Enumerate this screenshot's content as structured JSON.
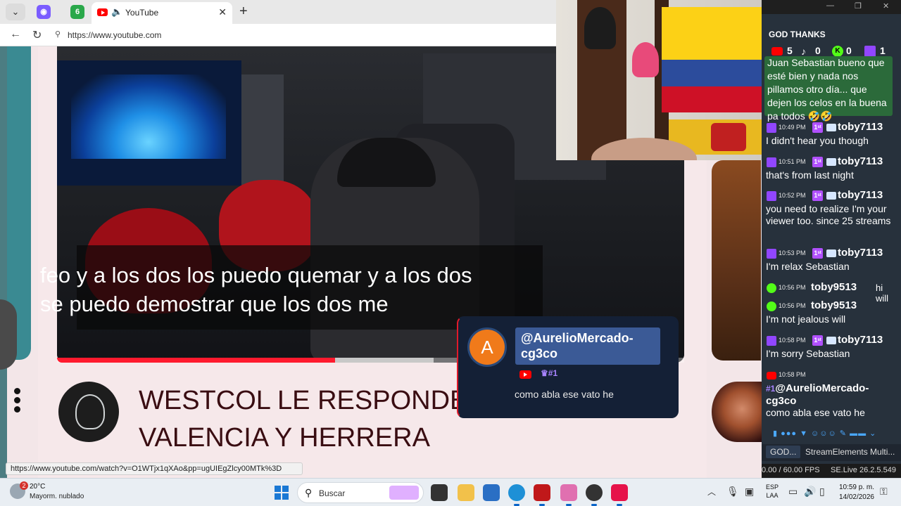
{
  "browser": {
    "tab_title": "YouTube",
    "mini_tab_2_label": "6",
    "url": "https://www.youtube.com",
    "status_url": "https://www.youtube.com/watch?v=O1WTjx1qXAo&pp=ugUIEgZlcy00MTk%3D"
  },
  "video": {
    "subtitle": "feo y a los dos los puedo quemar y a los dos se puedo demostrar que los dos me",
    "progress_fraction": 0.443,
    "buffer_fraction": 0.6,
    "title": "WESTCOL LE RESPONDE A VALENCIA Y HERRERA"
  },
  "notification": {
    "avatar_letter": "A",
    "username": "@AurelioMercado-cg3co",
    "badge": "#1",
    "message": "como abla ese vato he"
  },
  "chat": {
    "header": "GOD THANKS",
    "counts": {
      "youtube": "5",
      "tiktok": "0",
      "kick": "0",
      "twitch": "1"
    },
    "first_message": "Juan Sebastian bueno que esté bien y nada nos pillamos otro día... que dejen los celos en la buena pa todos 🤣🤣",
    "messages": [
      {
        "platform": "twitch",
        "time": "10:49 PM",
        "user": "toby7113",
        "text": "I didn't hear you though"
      },
      {
        "platform": "twitch",
        "time": "10:51 PM",
        "user": "toby7113",
        "text": "that's from last night"
      },
      {
        "platform": "twitch",
        "time": "10:52 PM",
        "user": "toby7113",
        "text": "you need to realize I'm your viewer too. since 25 streams"
      },
      {
        "platform": "twitch",
        "time": "10:53 PM",
        "user": "toby7113",
        "text": "I'm relax Sebastian"
      },
      {
        "platform": "kick",
        "time": "10:56 PM",
        "user": "toby9513",
        "inline": "hi will"
      },
      {
        "platform": "kick",
        "time": "10:56 PM",
        "user": "toby9513",
        "text": "I'm not jealous will"
      },
      {
        "platform": "twitch",
        "time": "10:58 PM",
        "user": "toby7113",
        "text": "I'm sorry Sebastian"
      },
      {
        "platform": "youtube",
        "time": "10:58 PM",
        "user": "@AurelioMercado-cg3co",
        "badge": "#1",
        "text": "como abla ese vato he"
      }
    ],
    "dock_tab_1": "GOD...",
    "dock_tab_2": "StreamElements Multi...",
    "fps": "0.00 / 60.00 FPS",
    "version": "SE.Live 26.2.5.549"
  },
  "taskbar": {
    "weather_badge": "2",
    "temperature": "20°C",
    "weather": "Mayorm. nublado",
    "search_placeholder": "Buscar",
    "lang_1": "ESP",
    "lang_2": "LAA",
    "time": "10:59 p. m.",
    "date": "14/02/2026"
  },
  "colors": {
    "youtube_red": "#ff0000",
    "twitch_purple": "#9146ff",
    "kick_green": "#53fc18",
    "title_color": "#3a0d12"
  }
}
